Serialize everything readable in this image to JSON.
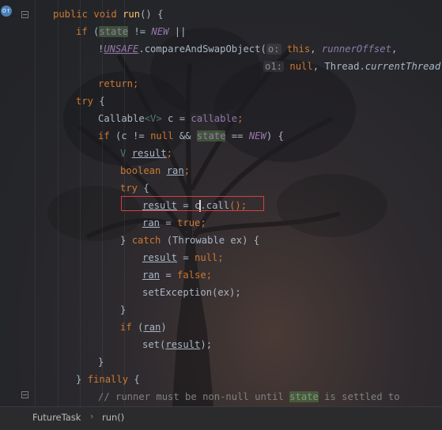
{
  "breadcrumb": {
    "class_name": "FutureTask",
    "method_name": "run()"
  },
  "code": {
    "l1": {
      "kw1": "public",
      "kw2": "void",
      "method": "run",
      "rest": "() {"
    },
    "l2": {
      "kw": "if",
      "open": " (",
      "field": "state",
      "op": " != ",
      "const": "NEW",
      "rest": " ||"
    },
    "l3": {
      "bang": "!",
      "unsafe": "UNSAFE",
      "dot": ".",
      "call": "compareAndSwapObject",
      "open": "(",
      "hint": "o:",
      "sp": " ",
      "this": "this",
      "comma": ", ",
      "param": "runnerOffset",
      "tail": ","
    },
    "l4": {
      "hint": "o1:",
      "sp": " ",
      "null": "null",
      "comma": ", ",
      "cls": "Thread",
      "dot": ".",
      "call": "currentThread",
      "tail": "()"
    },
    "l5": {
      "kw": "return",
      "tail": ";"
    },
    "l6": {
      "kw": "try",
      "tail": " {"
    },
    "l7": {
      "type": "Callable",
      "gen": "<V>",
      "mid": " c = ",
      "field": "callable",
      "tail": ";"
    },
    "l8": {
      "kw": "if",
      "a": " (c != ",
      "null": "null",
      "b": " && ",
      "field": "state",
      "c": " == ",
      "const": "NEW",
      "tail": ") {"
    },
    "l9": {
      "type": "V",
      "sp": " ",
      "var": "result",
      "tail": ";"
    },
    "l10": {
      "kw": "boolean",
      "sp": " ",
      "var": "ran",
      "tail": ";"
    },
    "l11": {
      "kw": "try",
      "tail": " {"
    },
    "l12": {
      "var": "result",
      "mid": " = c",
      "call": ".call",
      "tail": "();"
    },
    "l13": {
      "var": "ran",
      "mid": " = ",
      "kw": "true",
      "tail": ";"
    },
    "l14": {
      "close": "} ",
      "kw": "catch",
      "tail": " (Throwable ex) {"
    },
    "l15": {
      "var": "result",
      "mid": " = ",
      "kw": "null",
      "tail": ";"
    },
    "l16": {
      "var": "ran",
      "mid": " = ",
      "kw": "false",
      "tail": ";"
    },
    "l17": {
      "text": "setException(ex);"
    },
    "l18": {
      "text": "}"
    },
    "l19": {
      "kw": "if",
      "open": " (",
      "var": "ran",
      "tail": ")"
    },
    "l20": {
      "a": "set(",
      "var": "result",
      "tail": ");"
    },
    "l21": {
      "text": "}"
    },
    "l22": {
      "close": "} ",
      "kw": "finally",
      "tail": " {"
    },
    "l23": {
      "c1": "// runner must be non-null until ",
      "field": "state",
      "c2": " is settled to"
    }
  }
}
